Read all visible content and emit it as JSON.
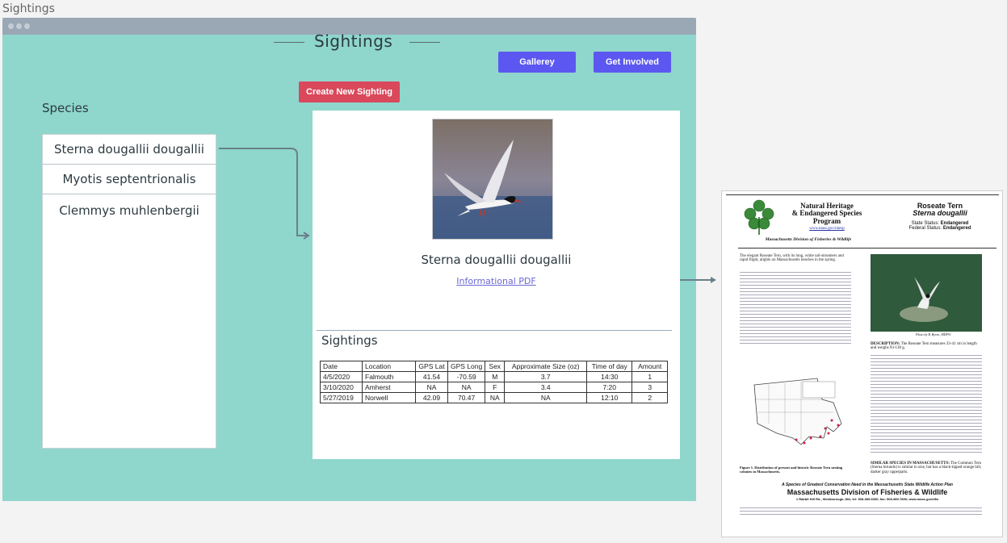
{
  "frame": {
    "label": "Sightings"
  },
  "header": {
    "title": "Sightings",
    "gallery_label": "Gallerey",
    "get_involved_label": "Get Involved",
    "create_label": "Create New Sighting"
  },
  "species": {
    "heading": "Species",
    "items": [
      {
        "label": "Sterna dougallii dougallii"
      },
      {
        "label": "Myotis septentrionalis"
      },
      {
        "label": "Clemmys muhlenbergii"
      }
    ]
  },
  "detail": {
    "species_name": "Sterna dougallii dougallii",
    "pdf_link": "Informational PDF",
    "sightings_heading": "Sightings",
    "table": {
      "headers": [
        "Date",
        "Location",
        "GPS Lat",
        "GPS Long",
        "Sex",
        "Approximate Size (oz)",
        "Time of day",
        "Amount"
      ],
      "rows": [
        [
          "4/5/2020",
          "Falmouth",
          "41.54",
          "-70.59",
          "M",
          "3.7",
          "14:30",
          "1"
        ],
        [
          "3/10/2020",
          "Amherst",
          "NA",
          "NA",
          "F",
          "3.4",
          "7:20",
          "3"
        ],
        [
          "5/27/2019",
          "Norwell",
          "42.09",
          "70.47",
          "NA",
          "NA",
          "12:10",
          "2"
        ]
      ]
    }
  },
  "pdf": {
    "program_line1": "Natural Heritage",
    "program_line2": "& Endangered Species",
    "program_line3": "Program",
    "program_url": "www.mass.gov/nhesp",
    "division": "Massachusetts Division of Fisheries & Wildlife",
    "species_common": "Roseate Tern",
    "species_latin": "Sterna dougallii",
    "state_status_label": "State Status:",
    "state_status": "Endangered",
    "federal_status_label": "Federal Status:",
    "federal_status": "Endangered",
    "intro_start": "The elegant Roseate Tern, with its long, white tail-streamers and rapid flight, alights on Massachusetts beaches in the spring.",
    "photo_credit": "Photo by B. Byrne, MDFW",
    "description_label": "DESCRIPTION:",
    "description_start": "The Roseate Tern measures 33-41 cm in length and weighs 93-130 g.",
    "figure_caption": "Figure 1. Distribution of present and historic Roseate Tern nesting colonies in Massachusetts.",
    "similar_label": "SIMILAR SPECIES IN MASSACHUSETTS:",
    "similar_start": "The Common Tern (Sterna hirundo) is similar in size, but has a black-tipped orange bill, darker gray upperparts.",
    "footer_tag": "A Species of Greatest Conservation Need in the Massachusetts State Wildlife Action Plan",
    "footer_division": "Massachusetts Division of Fisheries & Wildlife",
    "footer_address": "1 Rabbit Hill Rd., Westborough, MA; tel: 508-389-6300; fax: 508-389-7890; www.mass.gov/dfw"
  }
}
